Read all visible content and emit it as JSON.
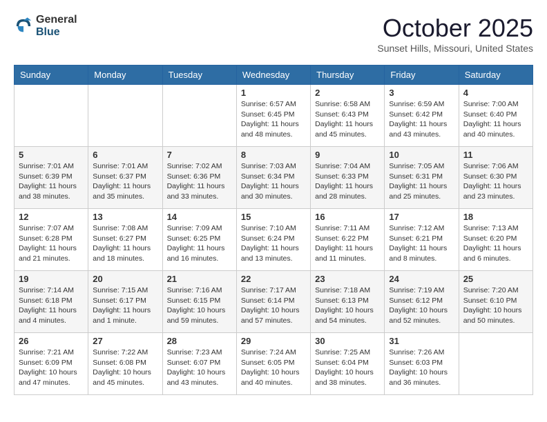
{
  "header": {
    "logo_general": "General",
    "logo_blue": "Blue",
    "month_title": "October 2025",
    "location": "Sunset Hills, Missouri, United States"
  },
  "weekdays": [
    "Sunday",
    "Monday",
    "Tuesday",
    "Wednesday",
    "Thursday",
    "Friday",
    "Saturday"
  ],
  "rows": [
    [
      {
        "day": "",
        "info": ""
      },
      {
        "day": "",
        "info": ""
      },
      {
        "day": "",
        "info": ""
      },
      {
        "day": "1",
        "info": "Sunrise: 6:57 AM\nSunset: 6:45 PM\nDaylight: 11 hours\nand 48 minutes."
      },
      {
        "day": "2",
        "info": "Sunrise: 6:58 AM\nSunset: 6:43 PM\nDaylight: 11 hours\nand 45 minutes."
      },
      {
        "day": "3",
        "info": "Sunrise: 6:59 AM\nSunset: 6:42 PM\nDaylight: 11 hours\nand 43 minutes."
      },
      {
        "day": "4",
        "info": "Sunrise: 7:00 AM\nSunset: 6:40 PM\nDaylight: 11 hours\nand 40 minutes."
      }
    ],
    [
      {
        "day": "5",
        "info": "Sunrise: 7:01 AM\nSunset: 6:39 PM\nDaylight: 11 hours\nand 38 minutes."
      },
      {
        "day": "6",
        "info": "Sunrise: 7:01 AM\nSunset: 6:37 PM\nDaylight: 11 hours\nand 35 minutes."
      },
      {
        "day": "7",
        "info": "Sunrise: 7:02 AM\nSunset: 6:36 PM\nDaylight: 11 hours\nand 33 minutes."
      },
      {
        "day": "8",
        "info": "Sunrise: 7:03 AM\nSunset: 6:34 PM\nDaylight: 11 hours\nand 30 minutes."
      },
      {
        "day": "9",
        "info": "Sunrise: 7:04 AM\nSunset: 6:33 PM\nDaylight: 11 hours\nand 28 minutes."
      },
      {
        "day": "10",
        "info": "Sunrise: 7:05 AM\nSunset: 6:31 PM\nDaylight: 11 hours\nand 25 minutes."
      },
      {
        "day": "11",
        "info": "Sunrise: 7:06 AM\nSunset: 6:30 PM\nDaylight: 11 hours\nand 23 minutes."
      }
    ],
    [
      {
        "day": "12",
        "info": "Sunrise: 7:07 AM\nSunset: 6:28 PM\nDaylight: 11 hours\nand 21 minutes."
      },
      {
        "day": "13",
        "info": "Sunrise: 7:08 AM\nSunset: 6:27 PM\nDaylight: 11 hours\nand 18 minutes."
      },
      {
        "day": "14",
        "info": "Sunrise: 7:09 AM\nSunset: 6:25 PM\nDaylight: 11 hours\nand 16 minutes."
      },
      {
        "day": "15",
        "info": "Sunrise: 7:10 AM\nSunset: 6:24 PM\nDaylight: 11 hours\nand 13 minutes."
      },
      {
        "day": "16",
        "info": "Sunrise: 7:11 AM\nSunset: 6:22 PM\nDaylight: 11 hours\nand 11 minutes."
      },
      {
        "day": "17",
        "info": "Sunrise: 7:12 AM\nSunset: 6:21 PM\nDaylight: 11 hours\nand 8 minutes."
      },
      {
        "day": "18",
        "info": "Sunrise: 7:13 AM\nSunset: 6:20 PM\nDaylight: 11 hours\nand 6 minutes."
      }
    ],
    [
      {
        "day": "19",
        "info": "Sunrise: 7:14 AM\nSunset: 6:18 PM\nDaylight: 11 hours\nand 4 minutes."
      },
      {
        "day": "20",
        "info": "Sunrise: 7:15 AM\nSunset: 6:17 PM\nDaylight: 11 hours\nand 1 minute."
      },
      {
        "day": "21",
        "info": "Sunrise: 7:16 AM\nSunset: 6:15 PM\nDaylight: 10 hours\nand 59 minutes."
      },
      {
        "day": "22",
        "info": "Sunrise: 7:17 AM\nSunset: 6:14 PM\nDaylight: 10 hours\nand 57 minutes."
      },
      {
        "day": "23",
        "info": "Sunrise: 7:18 AM\nSunset: 6:13 PM\nDaylight: 10 hours\nand 54 minutes."
      },
      {
        "day": "24",
        "info": "Sunrise: 7:19 AM\nSunset: 6:12 PM\nDaylight: 10 hours\nand 52 minutes."
      },
      {
        "day": "25",
        "info": "Sunrise: 7:20 AM\nSunset: 6:10 PM\nDaylight: 10 hours\nand 50 minutes."
      }
    ],
    [
      {
        "day": "26",
        "info": "Sunrise: 7:21 AM\nSunset: 6:09 PM\nDaylight: 10 hours\nand 47 minutes."
      },
      {
        "day": "27",
        "info": "Sunrise: 7:22 AM\nSunset: 6:08 PM\nDaylight: 10 hours\nand 45 minutes."
      },
      {
        "day": "28",
        "info": "Sunrise: 7:23 AM\nSunset: 6:07 PM\nDaylight: 10 hours\nand 43 minutes."
      },
      {
        "day": "29",
        "info": "Sunrise: 7:24 AM\nSunset: 6:05 PM\nDaylight: 10 hours\nand 40 minutes."
      },
      {
        "day": "30",
        "info": "Sunrise: 7:25 AM\nSunset: 6:04 PM\nDaylight: 10 hours\nand 38 minutes."
      },
      {
        "day": "31",
        "info": "Sunrise: 7:26 AM\nSunset: 6:03 PM\nDaylight: 10 hours\nand 36 minutes."
      },
      {
        "day": "",
        "info": ""
      }
    ]
  ]
}
